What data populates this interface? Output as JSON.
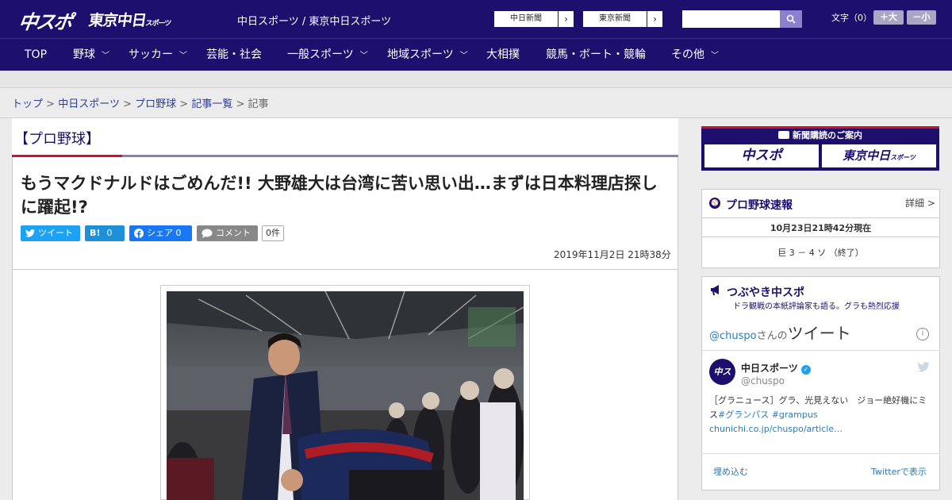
{
  "header": {
    "logo_primary": "中スポ",
    "logo_secondary": "東京中日",
    "logo_secondary_small": "スポーツ",
    "site_names": "中日スポーツ / 東京中日スポーツ",
    "ext_links": [
      {
        "label": "中日新聞"
      },
      {
        "label": "東京新聞"
      }
    ],
    "search_placeholder": "",
    "font_size_label": "文字（0）",
    "font_bigger": "＋大",
    "font_smaller": "－小"
  },
  "nav": {
    "items": [
      {
        "label": "TOP",
        "dropdown": false
      },
      {
        "label": "野球",
        "dropdown": true
      },
      {
        "label": "サッカー",
        "dropdown": true
      },
      {
        "label": "芸能・社会",
        "dropdown": false
      },
      {
        "label": "一般スポーツ",
        "dropdown": true
      },
      {
        "label": "地域スポーツ",
        "dropdown": true
      },
      {
        "label": "大相撲",
        "dropdown": false
      },
      {
        "label": "競馬・ボート・競輪",
        "dropdown": false
      },
      {
        "label": "その他",
        "dropdown": true
      }
    ]
  },
  "breadcrumb": {
    "items": [
      "トップ",
      "中日スポーツ",
      "プロ野球",
      "記事一覧"
    ],
    "current": "記事",
    "sep": ">"
  },
  "article": {
    "category": "【プロ野球】",
    "title": "もうマクドナルドはごめんだ!! 大野雄大は台湾に苦い思い出…まずは日本料理店探しに躍起!?",
    "share": {
      "tweet": "ツイート",
      "hatena_label": "B!",
      "hatena_count": "0",
      "facebook": "シェア 0",
      "comment": "コメント",
      "comment_count": "0件"
    },
    "date": "2019年11月2日 21時38分"
  },
  "sidebar": {
    "subscription": {
      "title": "新聞購読のご案内",
      "btn1": "中スポ",
      "btn2": "東京中日",
      "btn2_small": "スポーツ"
    },
    "baseball": {
      "title": "プロ野球速報",
      "detail": "詳細 >",
      "updated": "10月23日21時42分現在",
      "score": "巨 3 － 4 ソ （終了）"
    },
    "tweets": {
      "title": "つぶやき中スポ",
      "subtitle": "ドラ観戦の本紙評論家も語る。グラも熱烈応援",
      "handle_line_prefix": "@chuspo",
      "handle_line_middle": "さんの",
      "handle_line_big": "ツイート",
      "user_name": "中日スポーツ",
      "user_handle": "@chuspo",
      "tweet_text_plain": "［グラニュース］グラ、光見えない　ジョー絶好機にミス",
      "tweet_tags": "#グランパス #grampus",
      "tweet_link": "chunichi.co.jp/chuspo/article…",
      "embed": "埋め込む",
      "view_on": "Twitterで表示"
    }
  },
  "colors": {
    "brand": "#1c0f6e",
    "accent_red": "#d0102c",
    "twitter": "#1da1f2",
    "link": "#2a3d9a"
  }
}
